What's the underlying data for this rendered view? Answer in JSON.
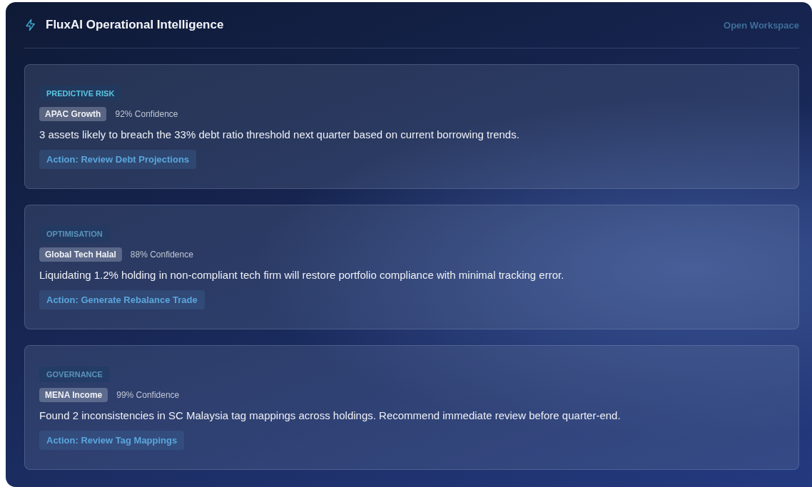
{
  "header": {
    "title": "FluxAI Operational Intelligence",
    "link": "Open Workspace"
  },
  "insights": [
    {
      "category": "PREDICTIVE RISK",
      "color": "#5cc6e0",
      "fund": "APAC Growth",
      "confidence": "92% Confidence",
      "message": "3 assets likely to breach the 33% debt ratio threshold next quarter based on current borrowing trends.",
      "action": "Action: Review Debt Projections"
    },
    {
      "category": "OPTIMISATION",
      "color": "#5a93bb",
      "fund": "Global Tech Halal",
      "confidence": "88% Confidence",
      "message": "Liquidating 1.2% holding in non-compliant tech firm will restore portfolio compliance with minimal tracking error.",
      "action": "Action: Generate Rebalance Trade"
    },
    {
      "category": "GOVERNANCE",
      "color": "#5a93bb",
      "fund": "MENA Income",
      "confidence": "99% Confidence",
      "message": "Found 2 inconsistencies in SC Malaysia tag mappings across holdings. Recommend immediate review before quarter-end.",
      "action": "Action: Review Tag Mappings"
    }
  ]
}
